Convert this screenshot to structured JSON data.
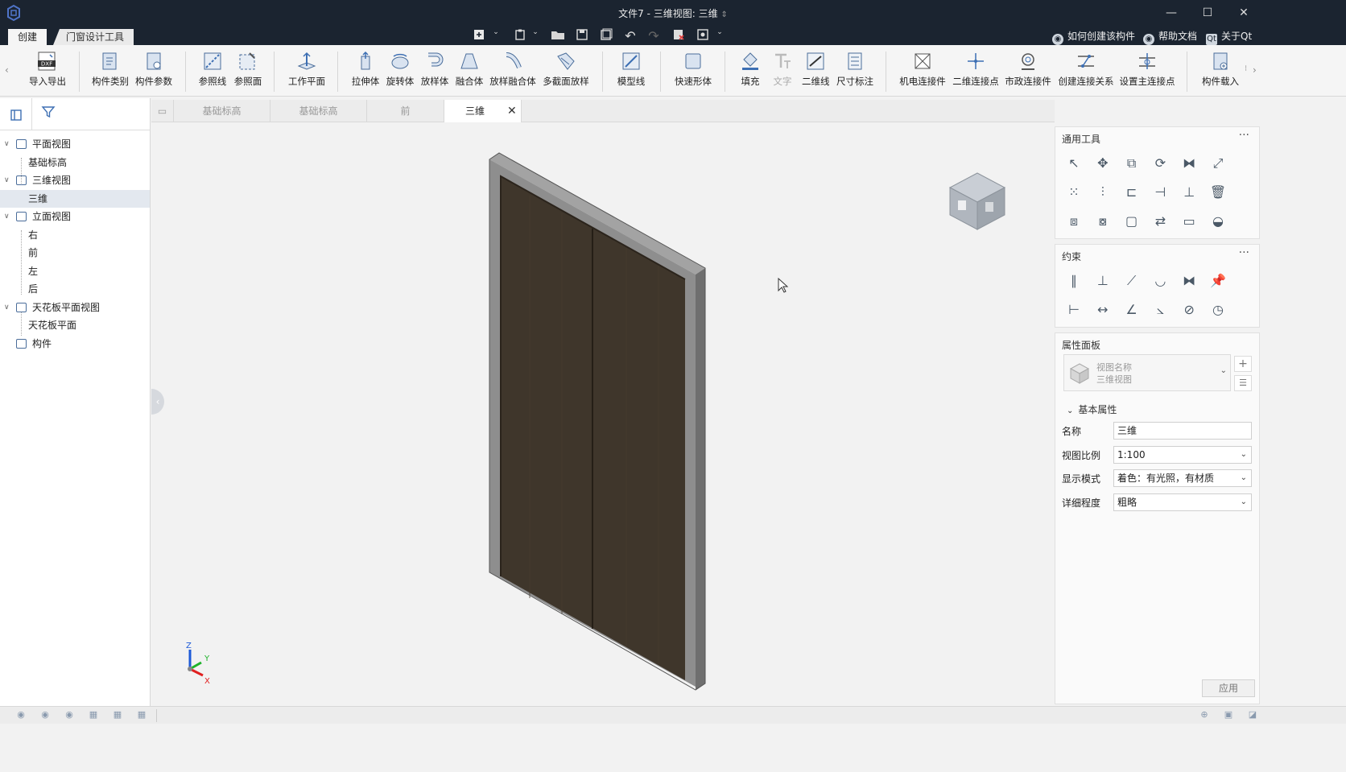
{
  "window": {
    "title": "文件7 - 三维视图: 三维",
    "title_suffix": "⇕",
    "controls": [
      "—",
      "☐",
      "✕"
    ]
  },
  "ribbon_tabs": [
    {
      "label": "创建",
      "active": true
    },
    {
      "label": "门窗设计工具",
      "active": false
    }
  ],
  "help_links": [
    {
      "label": "如何创建该构件",
      "icon": "location-icon"
    },
    {
      "label": "帮助文档",
      "icon": "location-icon"
    },
    {
      "label": "关于Qt",
      "icon": "qt-icon"
    }
  ],
  "ribbon": {
    "groups": [
      [
        {
          "label": "导入导出",
          "icon": "dxf-icon"
        }
      ],
      [
        {
          "label": "构件类别",
          "icon": "component-category-icon"
        },
        {
          "label": "构件参数",
          "icon": "component-param-icon"
        }
      ],
      [
        {
          "label": "参照线",
          "icon": "reference-line-icon"
        },
        {
          "label": "参照面",
          "icon": "reference-plane-icon"
        }
      ],
      [
        {
          "label": "工作平面",
          "icon": "work-plane-icon"
        }
      ],
      [
        {
          "label": "拉伸体",
          "icon": "extrude-icon"
        },
        {
          "label": "旋转体",
          "icon": "revolve-icon"
        },
        {
          "label": "放样体",
          "icon": "sweep-icon"
        },
        {
          "label": "融合体",
          "icon": "blend-icon"
        },
        {
          "label": "放样融合体",
          "icon": "swept-blend-icon"
        },
        {
          "label": "多截面放样",
          "icon": "multi-section-icon"
        }
      ],
      [
        {
          "label": "模型线",
          "icon": "model-line-icon"
        }
      ],
      [
        {
          "label": "快速形体",
          "icon": "quick-shape-icon"
        }
      ],
      [
        {
          "label": "填充",
          "icon": "fill-icon"
        },
        {
          "label": "文字",
          "icon": "text-icon",
          "disabled": true
        },
        {
          "label": "二维线",
          "icon": "2d-line-icon"
        },
        {
          "label": "尺寸标注",
          "icon": "dimension-icon"
        }
      ],
      [
        {
          "label": "机电连接件",
          "icon": "mep-connector-icon"
        },
        {
          "label": "二维连接点",
          "icon": "2d-connect-point-icon"
        },
        {
          "label": "市政连接件",
          "icon": "civil-connector-icon"
        },
        {
          "label": "创建连接关系",
          "icon": "create-connection-icon"
        },
        {
          "label": "设置主连接点",
          "icon": "set-main-point-icon"
        }
      ],
      [
        {
          "label": "构件载入",
          "icon": "component-load-icon"
        }
      ]
    ]
  },
  "tree": [
    {
      "label": "平面视图",
      "level": 0,
      "expand": "v",
      "icon": "plan-view-icon"
    },
    {
      "label": "基础标高",
      "level": 1
    },
    {
      "label": "三维视图",
      "level": 0,
      "expand": "v",
      "icon": "3d-view-icon"
    },
    {
      "label": "三维",
      "level": 1,
      "selected": true
    },
    {
      "label": "立面视图",
      "level": 0,
      "expand": "v",
      "icon": "elevation-view-icon"
    },
    {
      "label": "右",
      "level": 1
    },
    {
      "label": "前",
      "level": 1
    },
    {
      "label": "左",
      "level": 1
    },
    {
      "label": "后",
      "level": 1
    },
    {
      "label": "天花板平面视图",
      "level": 0,
      "expand": "v",
      "icon": "ceiling-view-icon"
    },
    {
      "label": "天花板平面",
      "level": 1
    },
    {
      "label": "构件",
      "level": 0,
      "expand": "",
      "icon": "component-icon"
    }
  ],
  "doc_tabs": [
    {
      "label": "基础标高",
      "active": false
    },
    {
      "label": "基础标高",
      "active": false
    },
    {
      "label": "前",
      "active": false
    },
    {
      "label": "三维",
      "active": true
    }
  ],
  "axis": {
    "z": "Z",
    "y": "Y",
    "x": "X"
  },
  "panels": {
    "general_tools": {
      "title": "通用工具",
      "more": "···",
      "tools": [
        "select-icon",
        "move-icon",
        "copy-icon",
        "rotate-icon",
        "mirror-icon",
        "scale-icon",
        "array-icon",
        "align-icon",
        "offset-icon",
        "trim-icon",
        "split-icon",
        "delete-icon",
        "group-icon",
        "ungroup-icon",
        "frame-icon",
        "replace-icon",
        "measure-icon",
        "angle-measure-icon"
      ]
    },
    "constraints": {
      "title": "约束",
      "more": "···",
      "tools": [
        "parallel-icon",
        "perpendicular-icon",
        "collinear-icon",
        "tangent-icon",
        "symmetric-icon",
        "fix-icon",
        "horizontal-dim-icon",
        "distance-icon",
        "angle-icon",
        "arc-angle-icon",
        "diameter-icon",
        "radius-icon"
      ]
    },
    "properties": {
      "title": "属性面板",
      "view_name": "视图名称",
      "view_type": "三维视图",
      "section": "基本属性",
      "rows": [
        {
          "label": "名称",
          "value": "三维",
          "dropdown": false
        },
        {
          "label": "视图比例",
          "value": "1:100",
          "dropdown": true
        },
        {
          "label": "显示模式",
          "value": "着色：有光照，有材质",
          "dropdown": true
        },
        {
          "label": "详细程度",
          "value": "粗略",
          "dropdown": true
        }
      ],
      "apply": "应用"
    }
  },
  "colors": {
    "titlebar": "#1b2430",
    "door_panel": "#3f362b",
    "door_frame": "#8e8e8e",
    "accent": "#3d6fb3"
  }
}
